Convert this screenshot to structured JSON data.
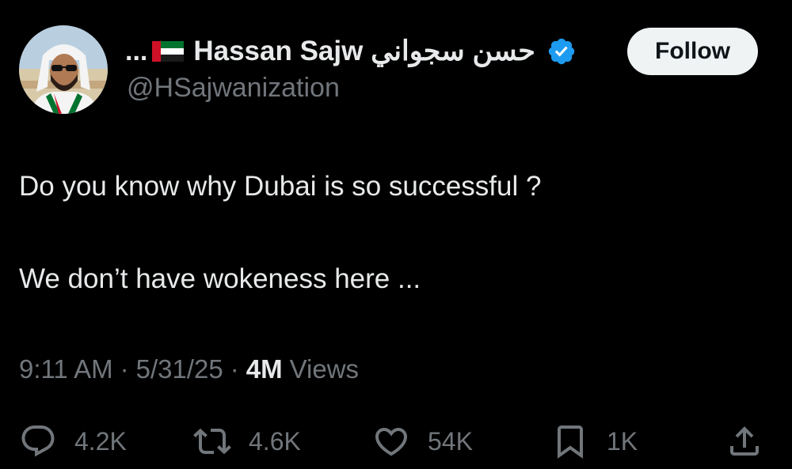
{
  "author": {
    "ellipsis": "...",
    "display_name": "Hassan Sajw حسن سجواني",
    "handle": "@HSajwanization",
    "flag_icon": "uae-flag-icon",
    "verified_icon": "verified-badge-icon"
  },
  "follow_label": "Follow",
  "tweet": {
    "line1": "Do you know why Dubai is so successful ?",
    "line2": "We don’t have wokeness here ..."
  },
  "meta": {
    "time": "9:11 AM",
    "date": "5/31/25",
    "separator": "·",
    "views_count": "4M",
    "views_label": "Views"
  },
  "actions": {
    "replies": "4.2K",
    "reposts": "4.6K",
    "likes": "54K",
    "bookmarks": "1K"
  },
  "colors": {
    "background": "#000000",
    "text": "#e7e9ea",
    "secondary": "#71767b",
    "verified": "#1d9bf0",
    "follow_bg": "#eff3f4"
  }
}
